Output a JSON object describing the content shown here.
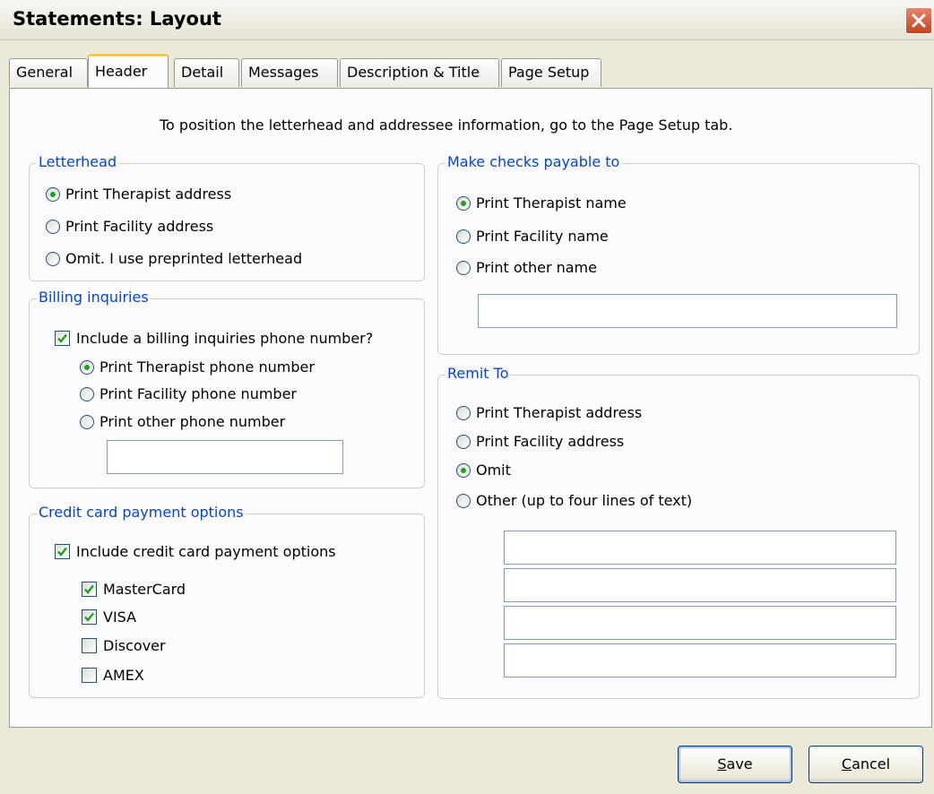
{
  "window": {
    "title": "Statements: Layout"
  },
  "tabs": [
    "General",
    "Header",
    "Detail",
    "Messages",
    "Description & Title",
    "Page Setup"
  ],
  "active_tab": "Header",
  "note": "To position the letterhead and addressee information, go to the Page Setup tab.",
  "letterhead": {
    "legend": "Letterhead",
    "options": [
      {
        "label": "Print Therapist address",
        "selected": true
      },
      {
        "label": "Print Facility address",
        "selected": false
      },
      {
        "label": "Omit. I use preprinted letterhead",
        "selected": false
      }
    ]
  },
  "billing": {
    "legend": "Billing inquiries",
    "include_label": "Include a billing inquiries phone number?",
    "include_checked": true,
    "options": [
      {
        "label": "Print Therapist phone number",
        "selected": true
      },
      {
        "label": "Print Facility phone number",
        "selected": false
      },
      {
        "label": "Print other phone number",
        "selected": false
      }
    ],
    "other_phone_value": ""
  },
  "credit": {
    "legend": "Credit card payment options",
    "include_label": "Include credit card payment options",
    "include_checked": true,
    "cards": [
      {
        "label": "MasterCard",
        "checked": true
      },
      {
        "label": "VISA",
        "checked": true
      },
      {
        "label": "Discover",
        "checked": false
      },
      {
        "label": "AMEX",
        "checked": false
      }
    ]
  },
  "payable": {
    "legend": "Make checks payable to",
    "options": [
      {
        "label": "Print Therapist name",
        "selected": true
      },
      {
        "label": "Print Facility name",
        "selected": false
      },
      {
        "label": "Print other name",
        "selected": false
      }
    ],
    "other_name_value": ""
  },
  "remit": {
    "legend": "Remit To",
    "options": [
      {
        "label": "Print Therapist address",
        "selected": false
      },
      {
        "label": "Print Facility address",
        "selected": false
      },
      {
        "label": "Omit",
        "selected": true
      },
      {
        "label": "Other (up to four lines of text)",
        "selected": false
      }
    ],
    "lines": [
      "",
      "",
      "",
      ""
    ]
  },
  "buttons": {
    "save": {
      "accel": "S",
      "rest": "ave"
    },
    "cancel": {
      "accel": "C",
      "rest": "ancel"
    }
  },
  "colors": {
    "legend": "#0046d5",
    "radio_dot": "#21a121",
    "check_mark": "#21a121",
    "tab_highlight": "#ffc83c",
    "close_button": "#c6441f"
  },
  "icons": {
    "close": "close-icon",
    "check": "checkmark-icon"
  }
}
